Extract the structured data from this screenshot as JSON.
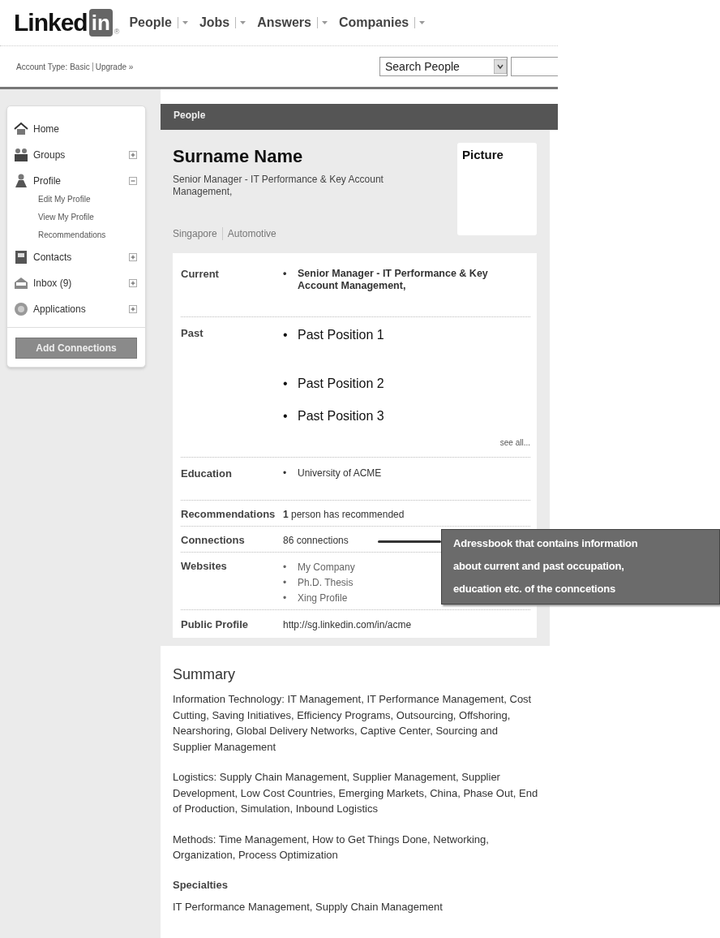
{
  "header": {
    "logo": {
      "word": "Linked",
      "badge": "in",
      "mark": "®"
    },
    "nav": [
      {
        "label": "People"
      },
      {
        "label": "Jobs"
      },
      {
        "label": "Answers"
      },
      {
        "label": "Companies"
      }
    ]
  },
  "account_bar": {
    "label": "Account Type:",
    "type": "Basic",
    "link": "Upgrade »",
    "search_scope": "Search People"
  },
  "sidebar": {
    "items": [
      {
        "kind": "link",
        "label": "Home"
      },
      {
        "kind": "section",
        "label": "Groups",
        "expanded": false
      },
      {
        "kind": "section",
        "label": "Profile",
        "expanded": true,
        "children": [
          {
            "label": "Edit My Profile"
          },
          {
            "label": "View My Profile"
          },
          {
            "label": "Recommendations"
          }
        ]
      },
      {
        "kind": "section",
        "label": "Contacts",
        "expanded": false
      },
      {
        "kind": "section",
        "label": "Inbox (9)",
        "expanded": false
      },
      {
        "kind": "section",
        "label": "Applications",
        "expanded": false
      }
    ],
    "button": "Add Connections"
  },
  "profile": {
    "section_title": "People",
    "name": "Surname Name",
    "headline": "Senior Manager - IT Performance & Key Account Management,",
    "picture_label": "Picture",
    "location": "Singapore",
    "industry": "Automotive",
    "details": [
      {
        "kind": "bold_list",
        "label": "Current",
        "bullet": "•",
        "items": [
          "Senior Manager - IT Performance & Key Account Management,"
        ]
      },
      {
        "kind": "large_list",
        "label": "Past",
        "bullet": "•",
        "items": [
          "Past Position 1",
          "Past Position 2",
          "Past Position 3"
        ],
        "more": "see all..."
      },
      {
        "kind": "list",
        "label": "Education",
        "bullet": "•",
        "items": [
          "University of ACME"
        ]
      },
      {
        "kind": "text",
        "label": "Recommendations",
        "value": "**1** person has recommended"
      },
      {
        "kind": "text",
        "label": "Connections",
        "value": "86 connections"
      },
      {
        "kind": "links",
        "label": "Websites",
        "bullet": "•",
        "items": [
          "My Company",
          "Ph.D. Thesis",
          "Xing Profile"
        ]
      },
      {
        "kind": "text",
        "label": "Public Profile",
        "value": "http://sg.linkedin.com/in/acme"
      }
    ]
  },
  "annotation": {
    "text": "Adressbook that contains information about current and past occupation, education etc. of the conncetions"
  },
  "summary": {
    "title": "Summary",
    "paragraphs": [
      "Information Technology: IT Management, IT Performance Management, Cost Cutting, Saving Initiatives, Efficiency Programs, Outsourcing, Offshoring, Nearshoring, Global Delivery Networks, Captive Center, Sourcing and Supplier Management",
      "Logistics: Supply Chain Management, Supplier Management, Supplier Development, Low Cost Countries, Emerging Markets, China, Phase Out, End of Production, Simulation, Inbound Logistics",
      "Methods: Time Management, How to Get Things Done, Networking, Organization, Process Optimization"
    ],
    "specialties_title": "Specialties",
    "specialties": "IT Performance Management, Supply Chain Management"
  }
}
